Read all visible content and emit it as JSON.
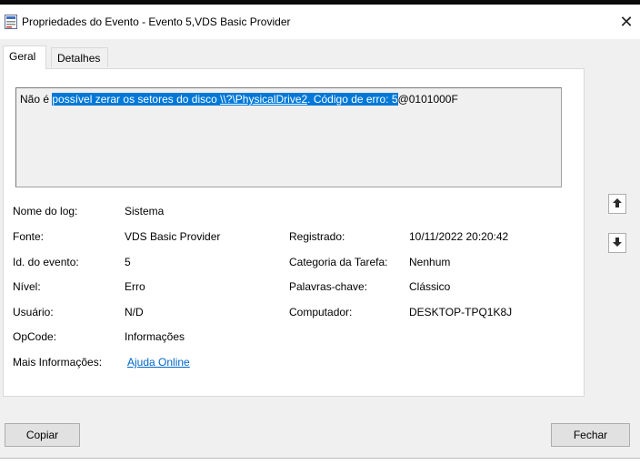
{
  "window": {
    "title": "Propriedades do Evento - Evento 5,VDS Basic Provider",
    "close_glyph": "✕"
  },
  "tabs": [
    {
      "label": "Geral",
      "active": true
    },
    {
      "label": "Detalhes",
      "active": false
    }
  ],
  "description": {
    "part1": "Não é ",
    "part2": "possível zerar os setores do disco ",
    "part3": "\\\\?\\PhysicalDrive2",
    "part4": ". Código de erro: 5",
    "part5": "@0101000F"
  },
  "fields": {
    "log_name": {
      "label": "Nome do log:",
      "value": "Sistema"
    },
    "source": {
      "label": "Fonte:",
      "value": "VDS Basic Provider"
    },
    "logged": {
      "label": "Registrado:",
      "value": "10/11/2022 20:20:42"
    },
    "event_id": {
      "label": "Id. do evento:",
      "value": "5"
    },
    "task_category": {
      "label": "Categoria da Tarefa:",
      "value": "Nenhum"
    },
    "level": {
      "label": "Nível:",
      "value": "Erro"
    },
    "keywords": {
      "label": "Palavras-chave:",
      "value": "Clássico"
    },
    "user": {
      "label": "Usuário:",
      "value": "N/D"
    },
    "computer": {
      "label": "Computador:",
      "value": "DESKTOP-TPQ1K8J"
    },
    "opcode": {
      "label": "OpCode:",
      "value": "Informações"
    },
    "more_info": {
      "label": "Mais Informações:",
      "link": "Ajuda Online"
    }
  },
  "buttons": {
    "copy": "Copiar",
    "close": "Fechar"
  },
  "colors": {
    "selection": "#0078d7",
    "link": "#0066cc"
  }
}
